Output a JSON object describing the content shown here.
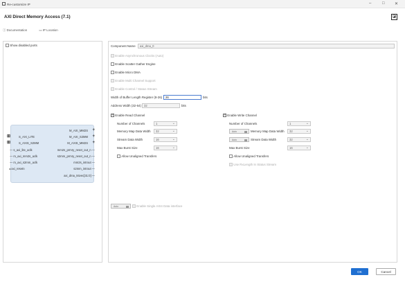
{
  "window": {
    "title": "Re-customize IP",
    "minimize": "–",
    "maximize": "□",
    "close": "✕"
  },
  "header": {
    "title": "AXI Direct Memory Access (7.1)",
    "brand_glyph": "◪"
  },
  "links": {
    "documentation": "Documentation",
    "ip_location": "IP Location"
  },
  "left_panel": {
    "show_disabled_ports": "Show disabled ports",
    "block": {
      "left_ports": [
        "S_AXI_LITE",
        "S_AXIS_S2MM",
        "s_axi_lite_aclk",
        "m_axi_mm2s_aclk",
        "m_axi_s2mm_aclk",
        "axi_resetn"
      ],
      "right_ports": [
        "M_AXI_MM2S",
        "M_AXI_S2MM",
        "M_AXIS_MM2S",
        "mm2s_prmry_reset_out_n",
        "s2mm_prmry_reset_out_n",
        "mm2s_introut",
        "s2mm_introut",
        "axi_dma_tstvec[31:0]"
      ]
    }
  },
  "config": {
    "component_name_label": "Component Name",
    "component_name_value": "axi_dma_0",
    "options": {
      "scatter_gather": "Enable Asynchronous Clocks (Auto)",
      "enable_sg": "Enable Scatter Gather Engine",
      "enable_micro": "Enable Micro DMA",
      "multi_channel": "Enable Multi Channel Support",
      "control_status": "Enable Control / Status Stream"
    },
    "buffer_length": {
      "label": "Width of Buffer Length Register (8-26)",
      "value": "26",
      "unit": "bits"
    },
    "address_width": {
      "label": "Address Width (32-64)",
      "value": "32",
      "unit": "bits"
    },
    "read": {
      "enable": "Enable Read Channel",
      "num_channels_label": "Number of Channels",
      "num_channels": "1",
      "mm_width_label": "Memory Map Data Width",
      "mm_width": "32",
      "stream_width_label": "Stream Data Width",
      "stream_width": "16",
      "burst_label": "Max Burst Size",
      "burst": "16",
      "unaligned": "Allow Unaligned Transfers"
    },
    "write": {
      "enable": "Enable Write Channel",
      "num_channels_label": "Number of Channels",
      "num_channels": "1",
      "mm_width_label": "Memory Map Data Width",
      "mm_width": "32",
      "mm_toggle": "Auto",
      "stream_width_label": "Stream Data Width",
      "stream_width": "32",
      "stream_toggle": "Auto",
      "burst_label": "Max Burst Size",
      "burst": "16",
      "unaligned": "Allow Unaligned Transfers",
      "rxlength": "Use RxLength In Status Stream"
    },
    "single_axi": {
      "toggle": "Auto",
      "label": "Enable Single AXI4 Data interface"
    }
  },
  "footer": {
    "ok": "OK",
    "cancel": "Cancel"
  }
}
